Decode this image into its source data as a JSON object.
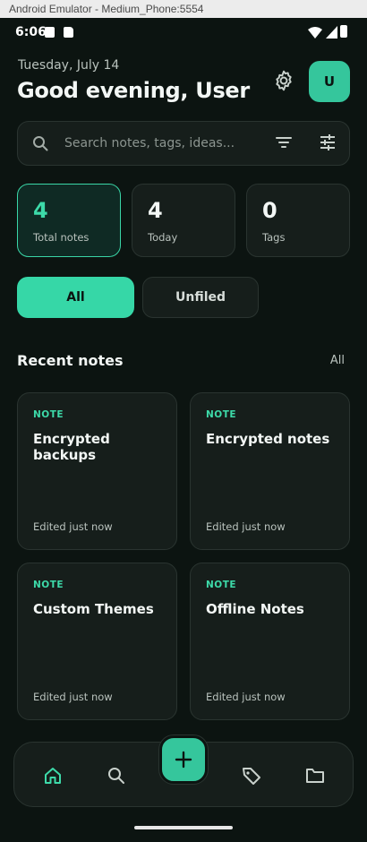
{
  "window": {
    "title": "Android Emulator - Medium_Phone:5554"
  },
  "status_bar": {
    "time": "6:06"
  },
  "header": {
    "date": "Tuesday, July 14",
    "greeting": "Good evening, User",
    "avatar_initial": "U",
    "settings_icon": "gear-icon"
  },
  "search": {
    "placeholder": "Search notes, tags, ideas...",
    "value": "",
    "icons": [
      "search-icon",
      "sort-icon",
      "tune-icon"
    ]
  },
  "stats": [
    {
      "value": "4",
      "label": "Total notes"
    },
    {
      "value": "4",
      "label": "Today"
    },
    {
      "value": "0",
      "label": "Tags"
    }
  ],
  "filters": {
    "all": "All",
    "unfiled": "Unfiled",
    "selected": "All"
  },
  "recent": {
    "title": "Recent notes",
    "see_all": "All",
    "notes": [
      {
        "kind": "NOTE",
        "title": "Encrypted backups",
        "edited": "Edited just now"
      },
      {
        "kind": "NOTE",
        "title": "Encrypted notes",
        "edited": "Edited just now"
      },
      {
        "kind": "NOTE",
        "title": "Custom Themes",
        "edited": "Edited just now"
      },
      {
        "kind": "NOTE",
        "title": "Offline Notes",
        "edited": "Edited just now"
      }
    ]
  },
  "bottom_nav": {
    "items": [
      "home-icon",
      "search-icon",
      "tag-icon",
      "folder-icon"
    ],
    "fab_icon": "plus-icon",
    "active": "home"
  },
  "colors": {
    "background": "#0c1411",
    "surface": "#161e1b",
    "accent": "#36d7a7",
    "text": "#f3f7f5",
    "muted": "#b9c2bd"
  }
}
